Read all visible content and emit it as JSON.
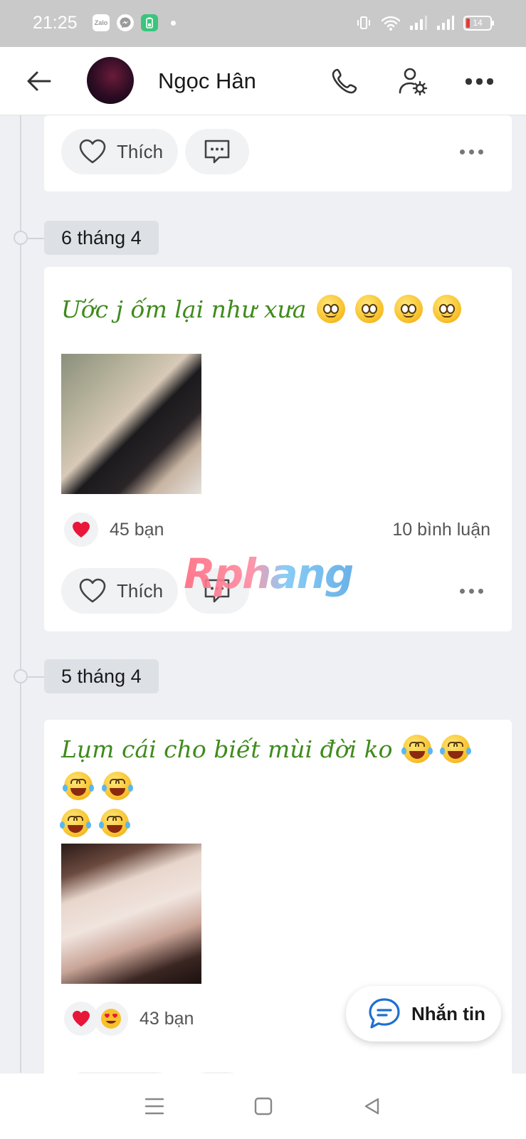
{
  "status_bar": {
    "time": "21:25",
    "apps": [
      "Zalo",
      "Messenger",
      "Battery saver"
    ],
    "battery_level": "14"
  },
  "header": {
    "name": "Ngọc Hân"
  },
  "actions": {
    "like_label": "Thích"
  },
  "posts": [
    {
      "date": "",
      "has_reactions": false
    },
    {
      "date": "6 tháng 4",
      "text": "Ước j ốm lại như xưa",
      "emoji": [
        "slightly-smiling-face",
        "slightly-smiling-face",
        "slightly-smiling-face",
        "slightly-smiling-face"
      ],
      "reaction_count": "45 bạn",
      "reactions": [
        "heart"
      ],
      "comment_count": "10 bình luận"
    },
    {
      "date": "5 tháng 4",
      "text": "Lụm cái cho biết mùi đời ko",
      "emoji": [
        "face-with-tears-of-joy",
        "face-with-tears-of-joy",
        "face-with-tears-of-joy",
        "face-with-tears-of-joy",
        "face-with-tears-of-joy",
        "face-with-tears-of-joy"
      ],
      "reaction_count": "43 bạn",
      "reactions": [
        "heart",
        "heart-eyes"
      ]
    }
  ],
  "watermark": "Rphang",
  "message_button": {
    "label": "Nhắn tin"
  },
  "colors": {
    "post_text": "#3f8b1c",
    "background": "#eef0f3",
    "accent_blue": "#1f6fd0"
  }
}
